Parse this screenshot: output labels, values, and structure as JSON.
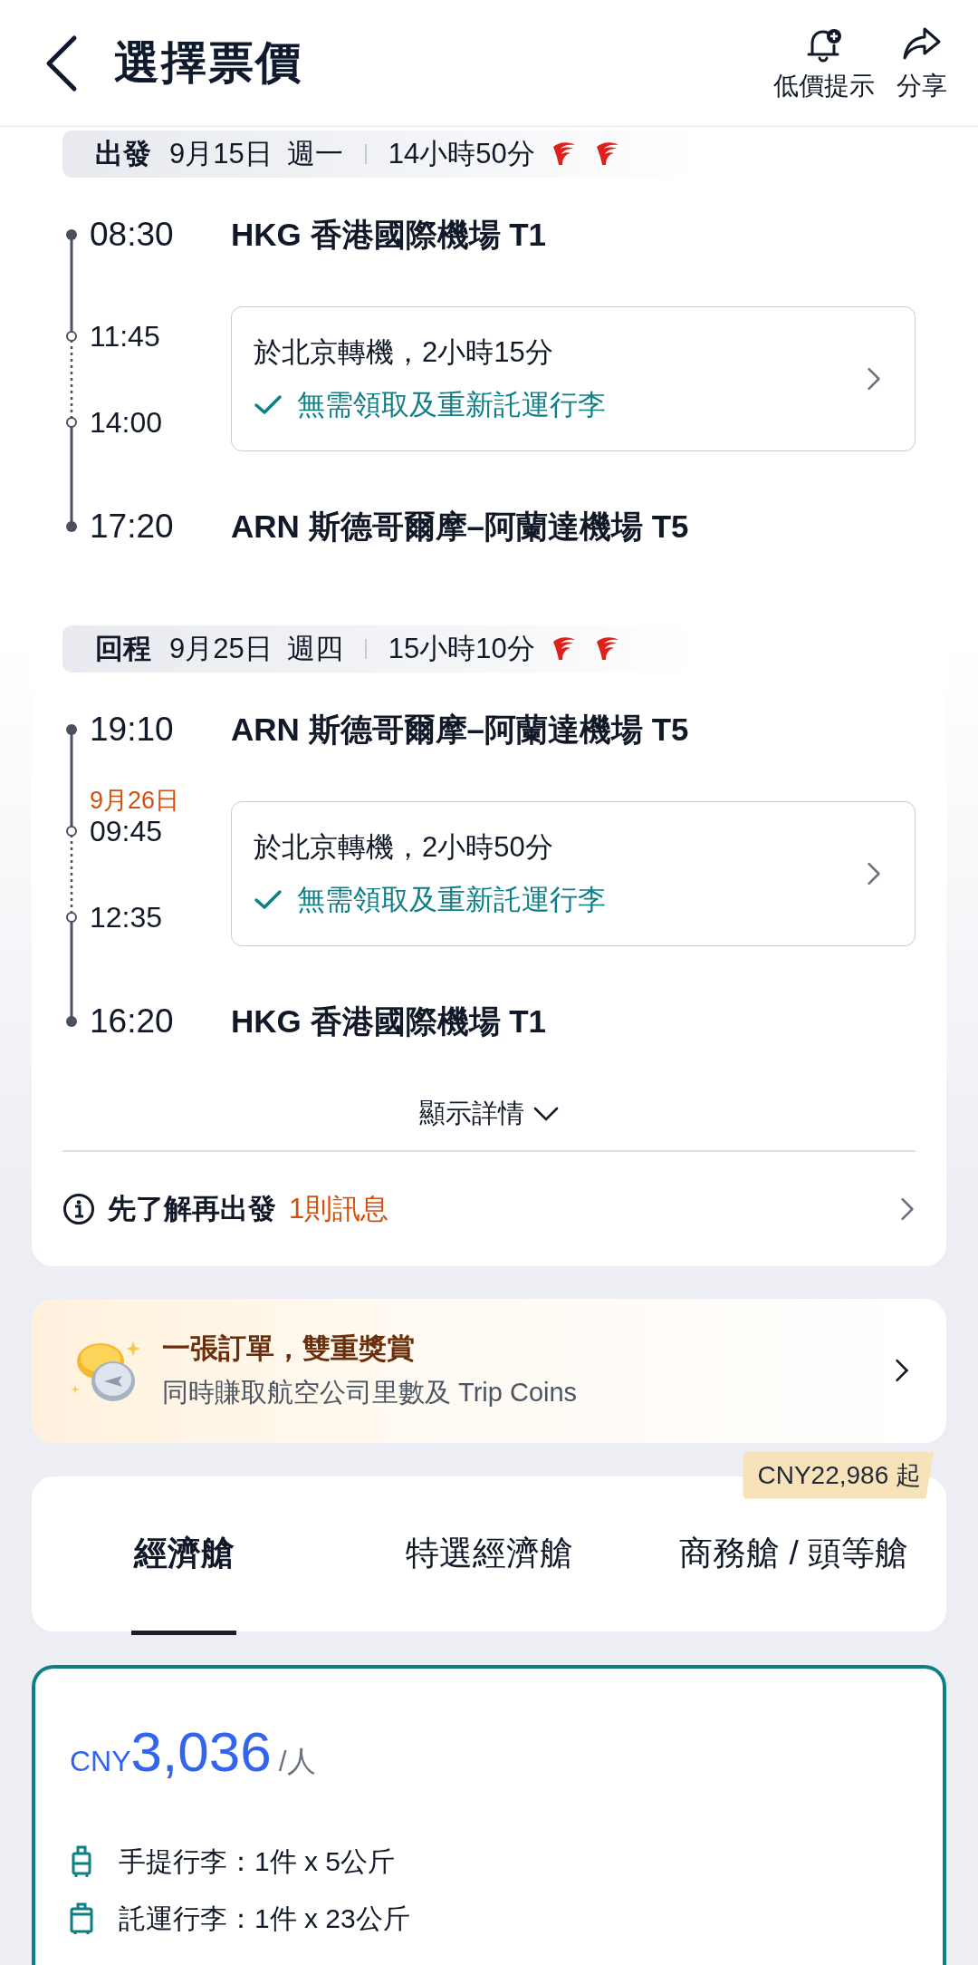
{
  "header": {
    "title": "選擇票價",
    "actions": [
      {
        "kind": "alert",
        "label": "低價提示"
      },
      {
        "kind": "share",
        "label": "分享"
      }
    ]
  },
  "legs": [
    {
      "label": "出發",
      "date": "9月15日",
      "weekday": "週一",
      "duration": "14小時50分",
      "departure": {
        "time": "08:30",
        "airport": "HKG 香港國際機場 T1"
      },
      "transfer": {
        "arrive_time": "11:45",
        "depart_time": "14:00",
        "text": "於北京轉機，2小時15分",
        "baggage_note": "無需領取及重新託運行李"
      },
      "arrival": {
        "time": "17:20",
        "airport": "ARN 斯德哥爾摩–阿蘭達機場 T5"
      }
    },
    {
      "label": "回程",
      "date": "9月25日",
      "weekday": "週四",
      "duration": "15小時10分",
      "departure": {
        "time": "19:10",
        "airport": "ARN 斯德哥爾摩–阿蘭達機場 T5"
      },
      "transfer": {
        "arrive_note": "9月26日",
        "arrive_time": "09:45",
        "depart_time": "12:35",
        "text": "於北京轉機，2小時50分",
        "baggage_note": "無需領取及重新託運行李"
      },
      "arrival": {
        "time": "16:20",
        "airport": "HKG 香港國際機場 T1"
      }
    }
  ],
  "show_details": "顯示詳情",
  "notice": {
    "text": "先了解再出發",
    "count": "1則訊息"
  },
  "promo": {
    "title": "一張訂單，雙重獎賞",
    "subtitle": "同時賺取航空公司里數及 Trip Coins"
  },
  "cabin_tabs": [
    {
      "label": "經濟艙",
      "selected": true
    },
    {
      "label": "特選經濟艙",
      "selected": false
    },
    {
      "label": "商務艙 / 頭等艙",
      "selected": false,
      "badge": "CNY22,986 起"
    }
  ],
  "fare": {
    "currency": "CNY",
    "amount": "3,036",
    "unit": "/人",
    "baggage": [
      {
        "kind": "carry_on",
        "text": "手提行李：1件 x 5公斤"
      },
      {
        "kind": "checked",
        "text": "託運行李：1件 x 23公斤"
      }
    ]
  }
}
